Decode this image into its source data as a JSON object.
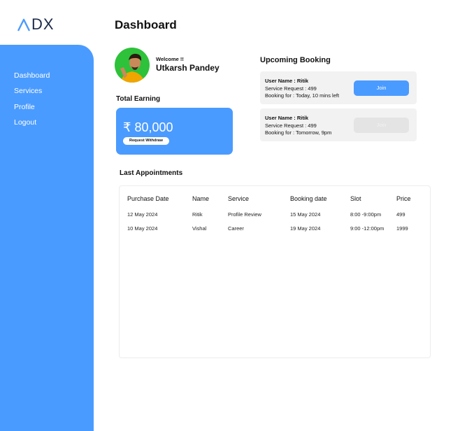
{
  "brand": {
    "logo_text": "DX"
  },
  "sidebar": {
    "items": [
      {
        "label": "Dashboard"
      },
      {
        "label": "Services"
      },
      {
        "label": "Profile"
      },
      {
        "label": "Logout"
      }
    ]
  },
  "header": {
    "title": "Dashboard"
  },
  "profile": {
    "welcome": "Welcome !!",
    "name": "Utkarsh Pandey"
  },
  "earning": {
    "title": "Total Earning",
    "amount": "₹ 80,000",
    "withdraw_label": "Request Withdraw"
  },
  "upcoming": {
    "title": "Upcoming Booking",
    "bookings": [
      {
        "user": "User Name : Ritik",
        "service": "Service Request : 499",
        "time": "Booking for : Today, 10 mins left",
        "join_label": "Join",
        "join_enabled": true
      },
      {
        "user": "User Name : Ritik",
        "service": "Service Request : 499",
        "time": "Booking for : Tomorrow, 9pm",
        "join_label": "Join",
        "join_enabled": false
      }
    ]
  },
  "appointments": {
    "title": "Last Appointments",
    "columns": [
      "Purchase Date",
      "Name",
      "Service",
      "Booking date",
      "Slot",
      "Price"
    ],
    "rows": [
      [
        "12 May 2024",
        "Ritik",
        "Profile Review",
        "15 May 2024",
        "8:00 -9:00pm",
        "499"
      ],
      [
        "10 May 2024",
        "Vishal",
        "Career",
        "19 May 2024",
        "9:00 -12:00pm",
        "1999"
      ]
    ]
  },
  "colors": {
    "accent": "#4a9bff",
    "card": "#f2f2f2",
    "avatar_bg": "#2ec13a",
    "disabled": "#e4e4e4"
  },
  "icons": {
    "logo": "logo-icon",
    "avatar": "avatar"
  }
}
